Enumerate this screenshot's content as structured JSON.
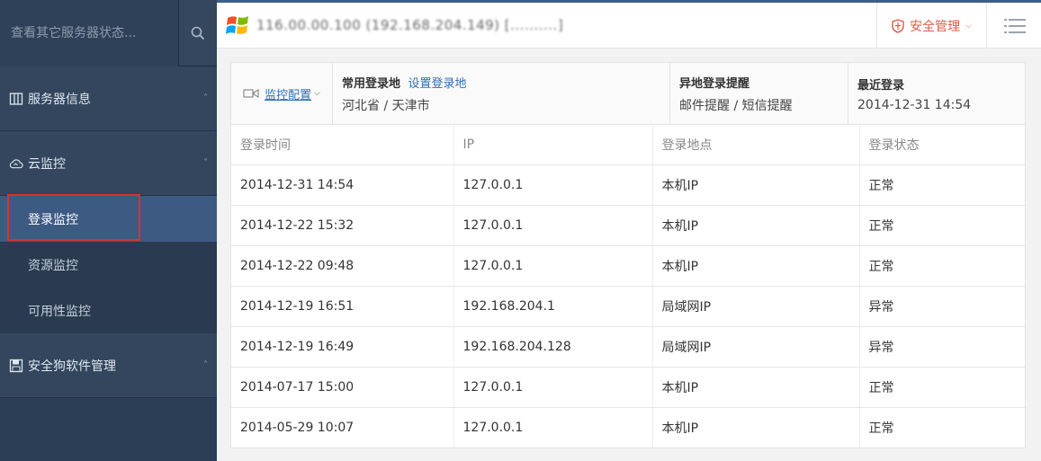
{
  "sidebar": {
    "search_placeholder": "查看其它服务器状态...",
    "groups": [
      {
        "label": "服务器信息",
        "icon": "server-info-icon",
        "arrow": "˄"
      },
      {
        "label": "云监控",
        "icon": "cloud-icon",
        "arrow": "˅"
      },
      {
        "label": "安全狗软件管理",
        "icon": "save-icon",
        "arrow": "˄"
      }
    ],
    "sub_items": [
      "登录监控",
      "资源监控",
      "可用性监控"
    ]
  },
  "header": {
    "server_name": "116.00.00.100 (192.168.204.149) [..........]",
    "security_menu_label": "安全管理",
    "colors": {
      "accent": "#e05a47",
      "topline": "#3d5e86"
    }
  },
  "info": {
    "config_label": "监控配置",
    "common_login_title": "常用登录地",
    "set_login_link": "设置登录地",
    "common_login_value": "河北省 / 天津市",
    "remote_alert_title": "异地登录提醒",
    "remote_alert_value": "邮件提醒 / 短信提醒",
    "recent_login_title": "最近登录",
    "recent_login_value": "2014-12-31 14:54"
  },
  "table": {
    "headers": [
      "登录时间",
      "IP",
      "登录地点",
      "登录状态"
    ],
    "rows": [
      [
        "2014-12-31 14:54",
        "127.0.0.1",
        "本机IP",
        "正常"
      ],
      [
        "2014-12-22 15:32",
        "127.0.0.1",
        "本机IP",
        "正常"
      ],
      [
        "2014-12-22 09:48",
        "127.0.0.1",
        "本机IP",
        "正常"
      ],
      [
        "2014-12-19 16:51",
        "192.168.204.1",
        "局域网IP",
        "异常"
      ],
      [
        "2014-12-19 16:49",
        "192.168.204.128",
        "局域网IP",
        "异常"
      ],
      [
        "2014-07-17 15:00",
        "127.0.0.1",
        "本机IP",
        "正常"
      ],
      [
        "2014-05-29 10:07",
        "127.0.0.1",
        "本机IP",
        "正常"
      ]
    ]
  }
}
